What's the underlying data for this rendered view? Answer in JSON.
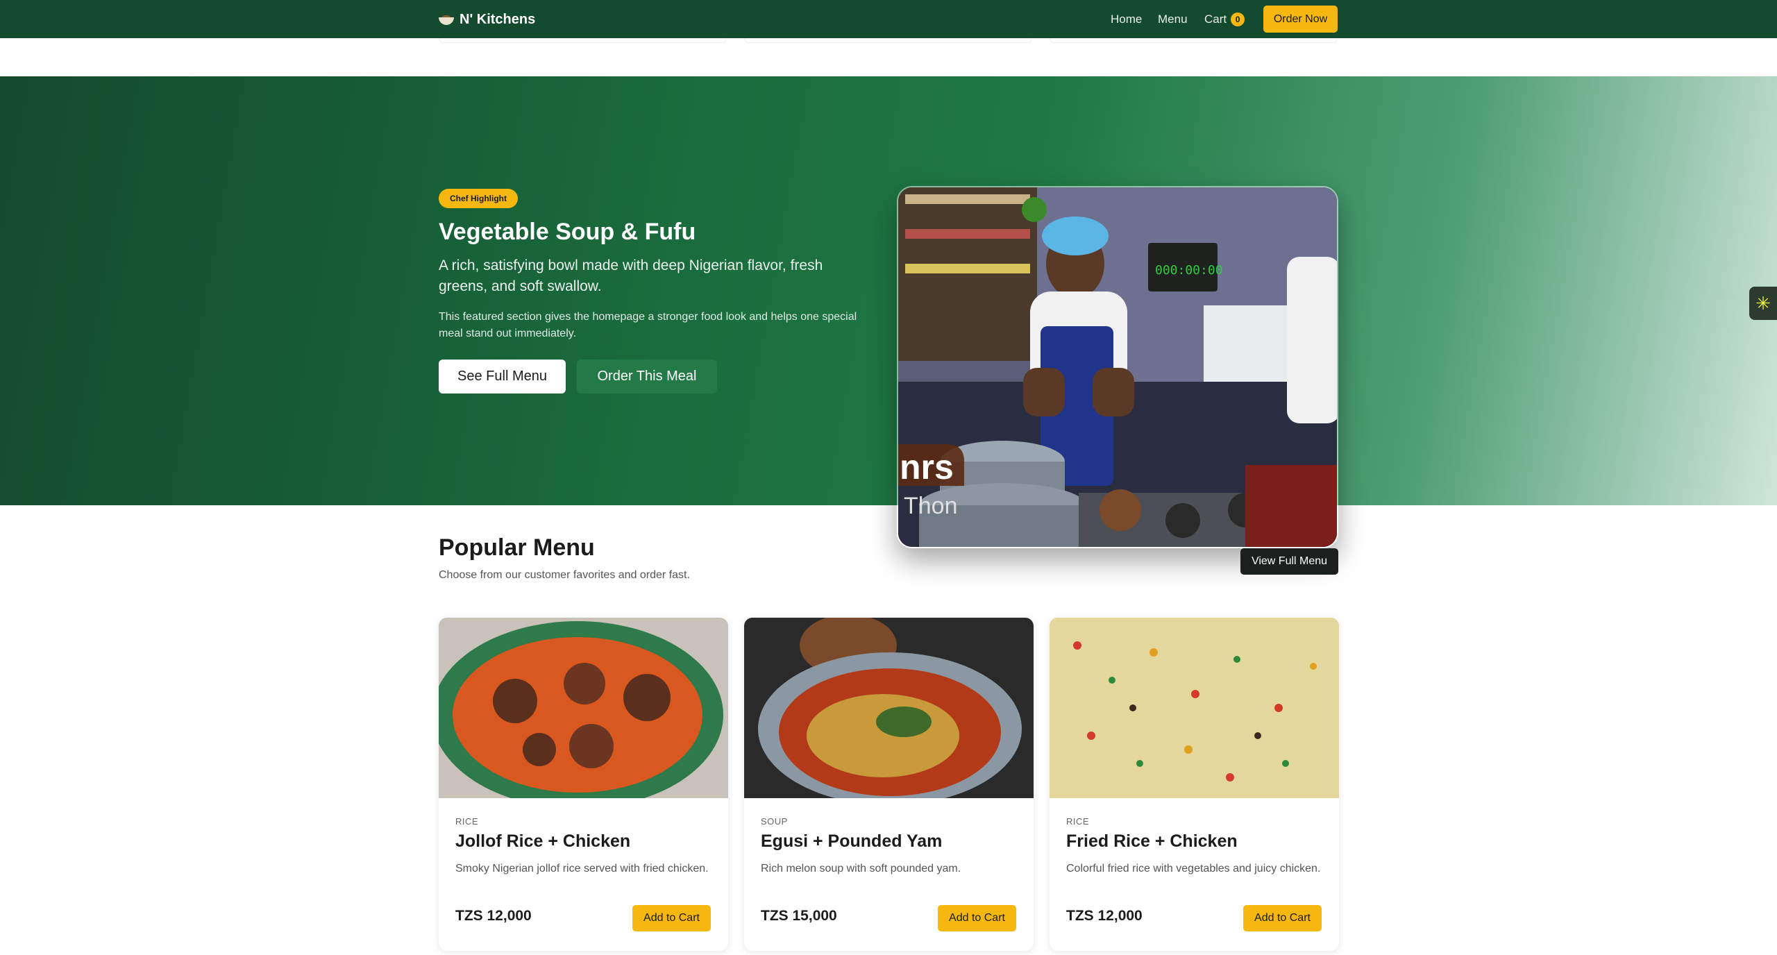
{
  "nav": {
    "brand": "N' Kitchens",
    "links": [
      "Home",
      "Menu",
      "Cart"
    ],
    "cart_count": "0",
    "order_now": "Order Now"
  },
  "hero": {
    "tag": "Chef Highlight",
    "title": "Vegetable Soup & Fufu",
    "subtitle": "A rich, satisfying bowl made with deep Nigerian flavor, fresh greens, and soft swallow.",
    "description": "This featured section gives the homepage a stronger food look and helps one special meal stand out immediately.",
    "primary_button": "See Full Menu",
    "secondary_button": "Order This Meal",
    "photo_overlay_text": [
      "nrs",
      "Thon"
    ],
    "photo_timer": "000:00:00"
  },
  "popular": {
    "title": "Popular Menu",
    "subtitle": "Choose from our customer favorites and order fast.",
    "view_full": "View Full Menu",
    "items": [
      {
        "category": "RICE",
        "name": "Jollof Rice + Chicken",
        "description": "Smoky Nigerian jollof rice served with fried chicken.",
        "price": "TZS 12,000",
        "button": "Add to Cart"
      },
      {
        "category": "SOUP",
        "name": "Egusi + Pounded Yam",
        "description": "Rich melon soup with soft pounded yam.",
        "price": "TZS 15,000",
        "button": "Add to Cart"
      },
      {
        "category": "RICE",
        "name": "Fried Rice + Chicken",
        "description": "Colorful fried rice with vegetables and juicy chicken.",
        "price": "TZS 12,000",
        "button": "Add to Cart"
      }
    ]
  },
  "colors": {
    "nav_bg": "#144a2e",
    "accent": "#f6b70f",
    "hero_start": "#134a2c",
    "hero_end": "#cfe6d7"
  },
  "icons": {
    "brand": "food-bowl-icon",
    "side_widget": "asterisk-icon"
  }
}
